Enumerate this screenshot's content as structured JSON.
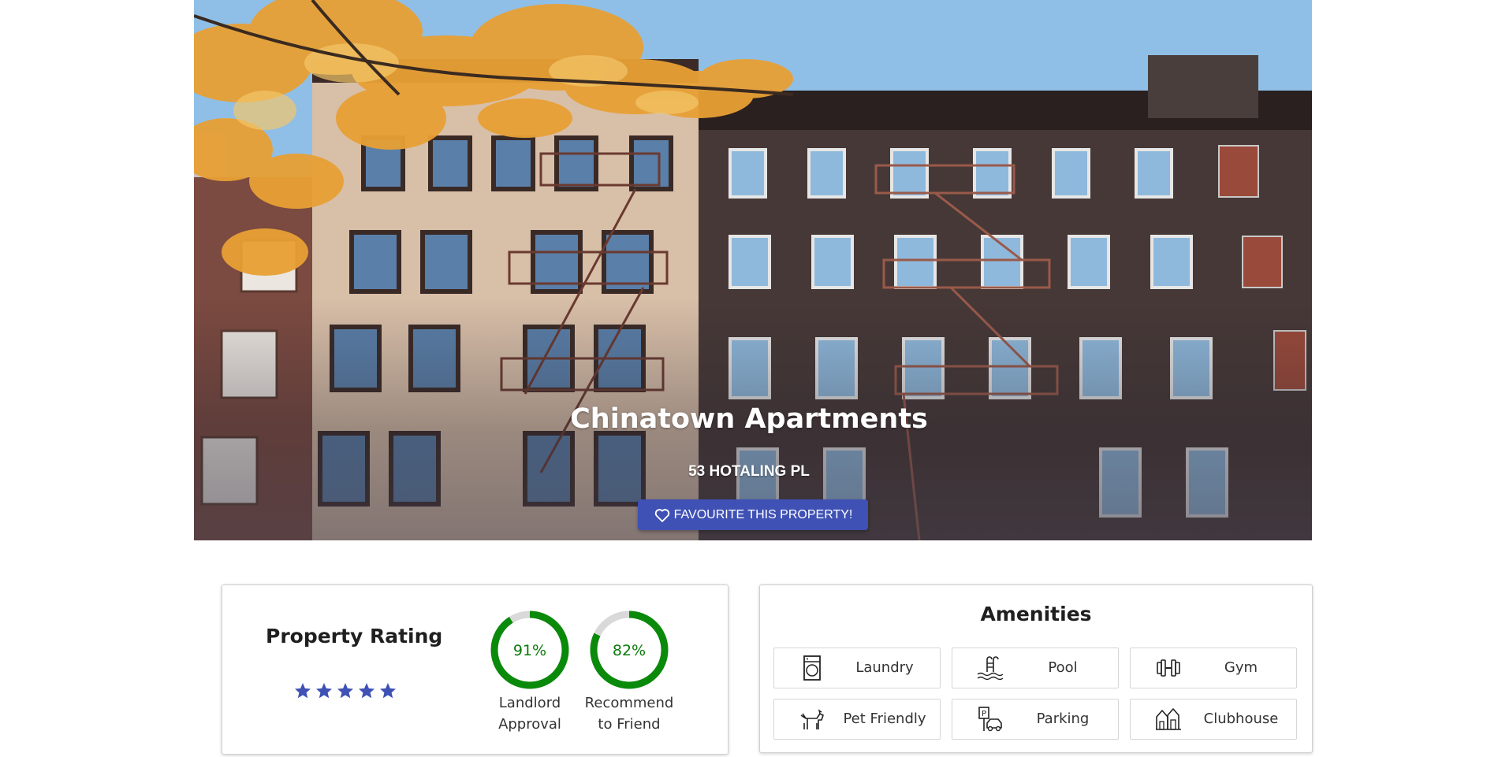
{
  "hero": {
    "title": "Chinatown Apartments",
    "address": "53 HOTALING PL",
    "favourite_label": "FAVOURITE THIS PROPERTY!",
    "favourite_icon": "heart-outline-icon"
  },
  "rating": {
    "title": "Property Rating",
    "stars": 5,
    "star_color": "#3f51b5",
    "gauges": [
      {
        "value": "91%",
        "fraction": 0.91,
        "line1": "Landlord",
        "line2": "Approval"
      },
      {
        "value": "82%",
        "fraction": 0.82,
        "line1": "Recommend",
        "line2": "to Friend"
      }
    ],
    "gauge_color": "#0a8a0a",
    "gauge_track_color": "#d9d9d9"
  },
  "amenities": {
    "title": "Amenities",
    "items": [
      {
        "label": "Laundry",
        "icon": "washing-machine-icon"
      },
      {
        "label": "Pool",
        "icon": "pool-ladder-icon"
      },
      {
        "label": "Gym",
        "icon": "dumbbell-icon"
      },
      {
        "label": "Pet Friendly",
        "icon": "dog-icon"
      },
      {
        "label": "Parking",
        "icon": "parking-car-icon"
      },
      {
        "label": "Clubhouse",
        "icon": "clubhouse-icon"
      }
    ]
  },
  "colors": {
    "primary": "#3f51b5",
    "success": "#0a8a0a"
  }
}
